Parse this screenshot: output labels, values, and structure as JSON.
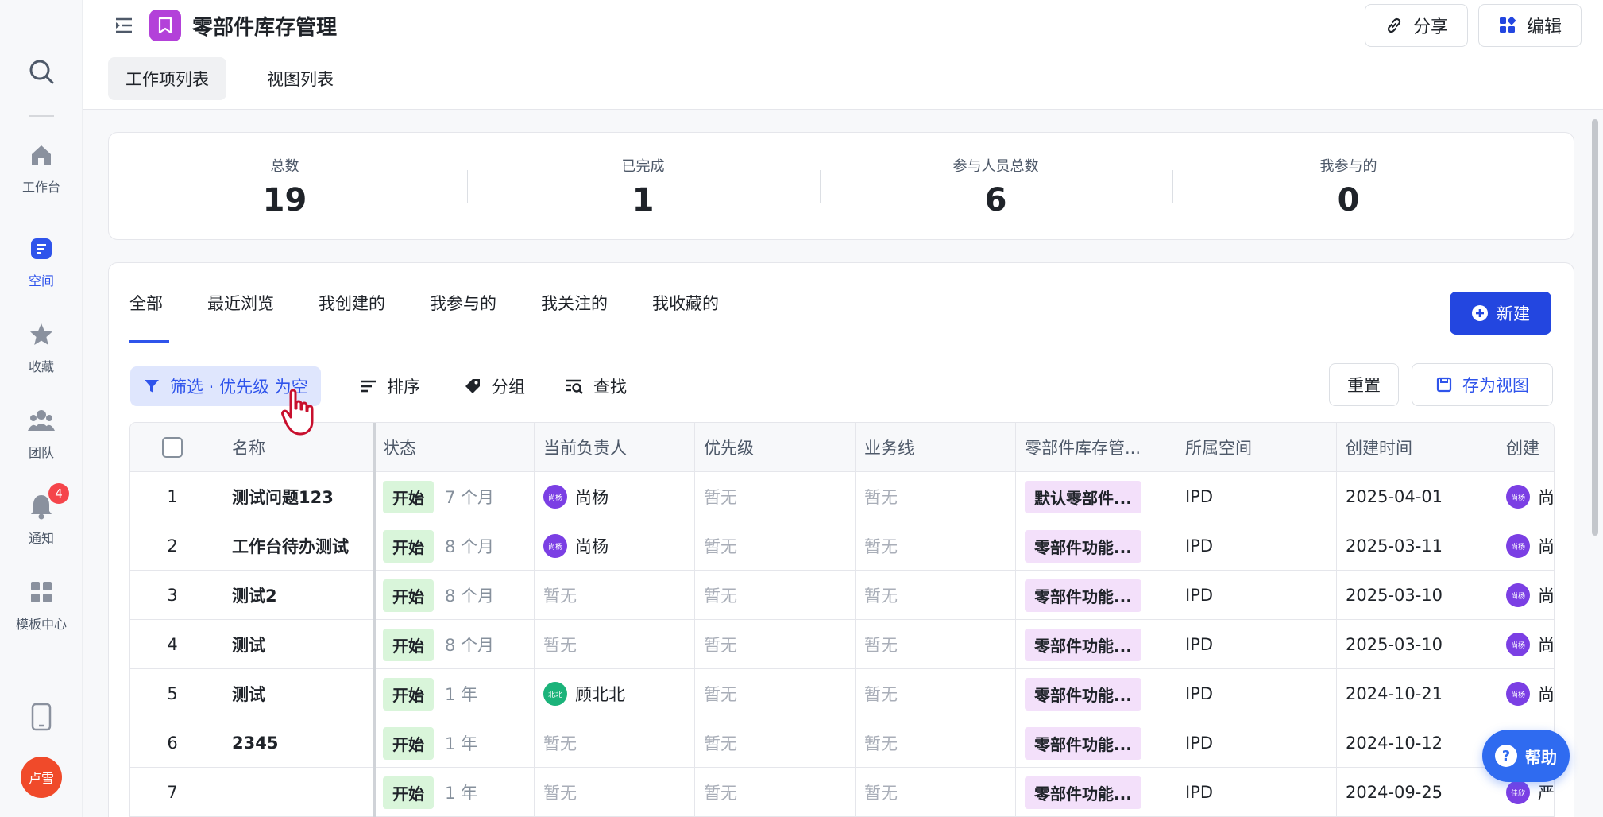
{
  "rail": {
    "items": [
      {
        "label": "工作台",
        "icon": "home-icon"
      },
      {
        "label": "空间",
        "icon": "space-icon"
      },
      {
        "label": "收藏",
        "icon": "star-icon"
      },
      {
        "label": "团队",
        "icon": "team-icon"
      },
      {
        "label": "通知",
        "icon": "bell-icon",
        "badge": "4"
      },
      {
        "label": "模板中心",
        "icon": "template-icon"
      }
    ],
    "user_avatar": "卢雪"
  },
  "header": {
    "title": "零部件库存管理",
    "share_label": "分享",
    "edit_label": "编辑",
    "view_tabs": [
      "工作项列表",
      "视图列表"
    ]
  },
  "stats": [
    {
      "label": "总数",
      "value": "19"
    },
    {
      "label": "已完成",
      "value": "1"
    },
    {
      "label": "参与人员总数",
      "value": "6"
    },
    {
      "label": "我参与的",
      "value": "0"
    }
  ],
  "filter_tabs": [
    "全部",
    "最近浏览",
    "我创建的",
    "我参与的",
    "我关注的",
    "我收藏的"
  ],
  "new_label": "新建",
  "toolbar": {
    "filter_label": "筛选 · 优先级 为空",
    "sort_label": "排序",
    "group_label": "分组",
    "find_label": "查找",
    "reset_label": "重置",
    "save_view_label": "存为视图"
  },
  "table": {
    "columns": [
      "名称",
      "状态",
      "当前负责人",
      "优先级",
      "业务线",
      "零部件库存管...",
      "所属空间",
      "创建时间",
      "创建"
    ],
    "rows": [
      {
        "no": "1",
        "name": "测试问题123",
        "status": "开始",
        "since": "7 个月",
        "owner_avatar": "尚杨",
        "owner": "尚杨",
        "priority": "暂无",
        "line": "暂无",
        "project": "默认零部件...",
        "space": "IPD",
        "created": "2025-04-01",
        "creator_avatar": "尚杨",
        "creator": "尚"
      },
      {
        "no": "2",
        "name": "工作台待办测试",
        "status": "开始",
        "since": "8 个月",
        "owner_avatar": "尚杨",
        "owner": "尚杨",
        "priority": "暂无",
        "line": "暂无",
        "project": "零部件功能...",
        "space": "IPD",
        "created": "2025-03-11",
        "creator_avatar": "尚杨",
        "creator": "尚"
      },
      {
        "no": "3",
        "name": "测试2",
        "status": "开始",
        "since": "8 个月",
        "owner_avatar": "",
        "owner": "暂无",
        "priority": "暂无",
        "line": "暂无",
        "project": "零部件功能...",
        "space": "IPD",
        "created": "2025-03-10",
        "creator_avatar": "尚杨",
        "creator": "尚"
      },
      {
        "no": "4",
        "name": "测试",
        "status": "开始",
        "since": "8 个月",
        "owner_avatar": "",
        "owner": "暂无",
        "priority": "暂无",
        "line": "暂无",
        "project": "零部件功能...",
        "space": "IPD",
        "created": "2025-03-10",
        "creator_avatar": "尚杨",
        "creator": "尚"
      },
      {
        "no": "5",
        "name": "测试",
        "status": "开始",
        "since": "1 年",
        "owner_avatar": "北北",
        "owner": "顾北北",
        "priority": "暂无",
        "line": "暂无",
        "project": "零部件功能...",
        "space": "IPD",
        "created": "2024-10-21",
        "creator_avatar": "尚杨",
        "creator": "尚"
      },
      {
        "no": "6",
        "name": "2345",
        "status": "开始",
        "since": "1 年",
        "owner_avatar": "",
        "owner": "暂无",
        "priority": "暂无",
        "line": "暂无",
        "project": "零部件功能...",
        "space": "IPD",
        "created": "2024-10-12",
        "creator_avatar": "",
        "creator": ""
      },
      {
        "no": "7",
        "name": "",
        "status": "开始",
        "since": "1 年",
        "owner_avatar": "",
        "owner": "暂无",
        "priority": "暂无",
        "line": "暂无",
        "project": "零部件功能...",
        "space": "IPD",
        "created": "2024-09-25",
        "creator_avatar": "佳欣",
        "creator": "严"
      }
    ]
  },
  "help_label": "帮助",
  "colors": {
    "accent": "#2346e0",
    "status_bg": "#d9f5da",
    "tag_bg": "#f3e0fa",
    "badge": "#f5454b"
  }
}
